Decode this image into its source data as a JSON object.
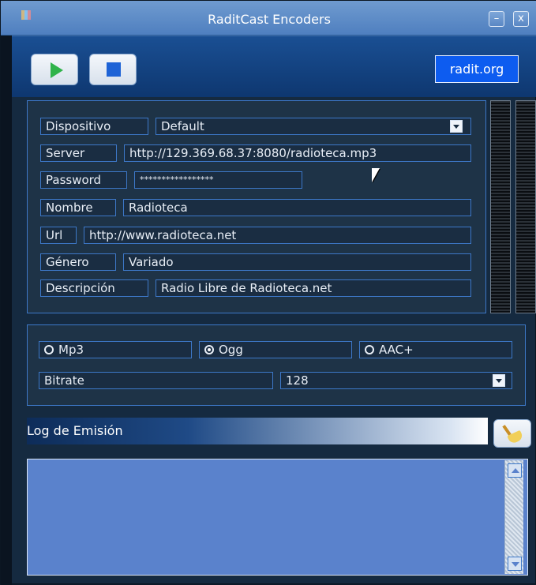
{
  "window": {
    "title": "RaditCast Encoders",
    "minimize_symbol": "–",
    "close_symbol": "x"
  },
  "toolbar": {
    "brand": "radit.org"
  },
  "form": {
    "device_label": "Dispositivo",
    "device_value": "Default",
    "server_label": "Server",
    "server_value": "http://129.369.68.37:8080/radioteca.mp3",
    "password_label": "Password",
    "password_value": "*****************",
    "name_label": "Nombre",
    "name_value": "Radioteca",
    "url_label": "Url",
    "url_value": "http://www.radioteca.net",
    "genre_label": "Género",
    "genre_value": "Variado",
    "description_label": "Descripción",
    "description_value": "Radio Libre de Radioteca.net"
  },
  "encoding": {
    "mp3_label": "Mp3",
    "ogg_label": "Ogg",
    "aac_label": "AAC+",
    "selected": "Ogg",
    "bitrate_label": "Bitrate",
    "bitrate_value": "128"
  },
  "log": {
    "title": "Log de Emisión"
  },
  "icons": {
    "play": "play-icon",
    "stop": "stop-icon",
    "clear": "broom-icon",
    "dropdown": "chevron-down-icon"
  },
  "colors": {
    "accent": "#3d78c8",
    "brand_bg": "#0d5cf0",
    "log_bg": "#5a82cc",
    "play_green": "#2fb34a",
    "stop_blue": "#1e63d6"
  }
}
